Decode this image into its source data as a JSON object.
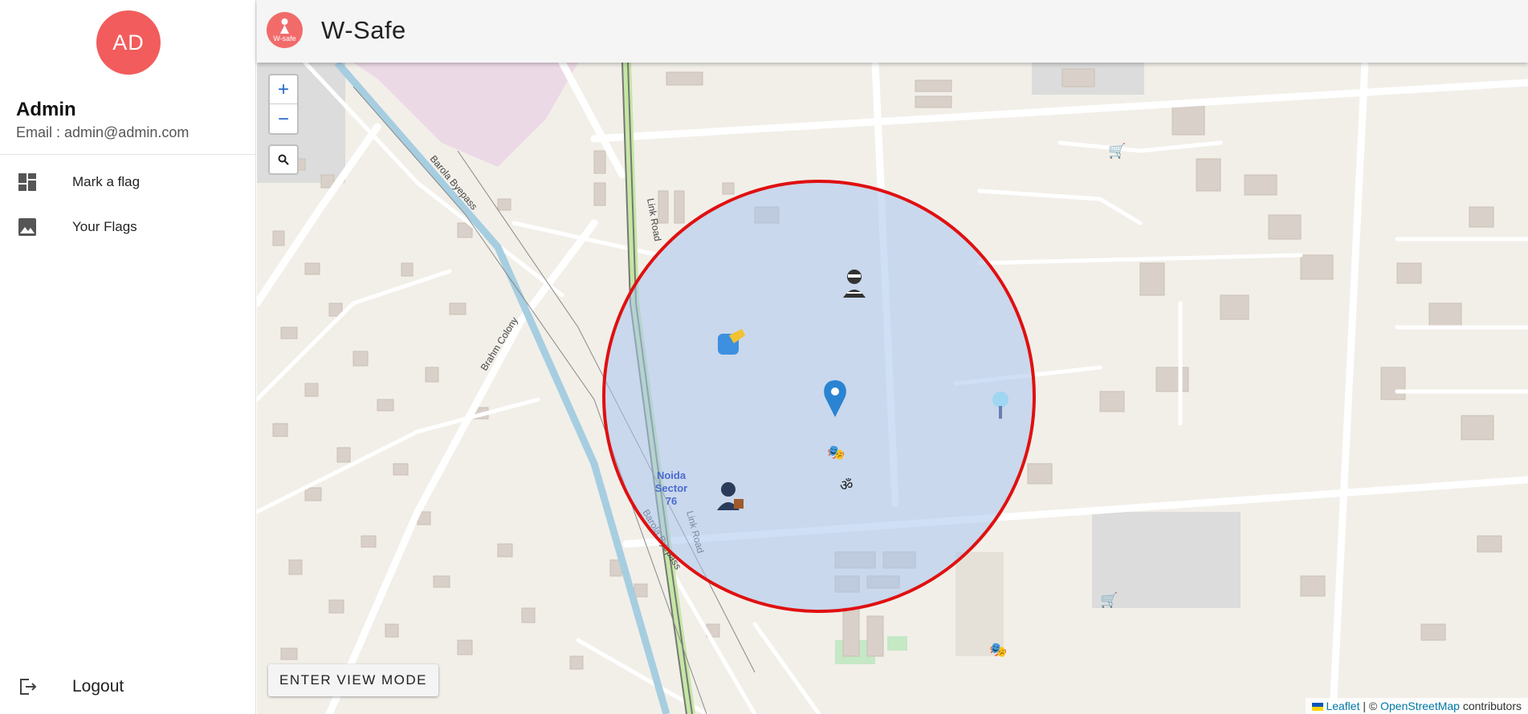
{
  "sidebar": {
    "avatar_initials": "AD",
    "user_name": "Admin",
    "user_email": "Email : admin@admin.com",
    "nav": [
      {
        "label": "Mark a flag",
        "icon": "dashboard-icon"
      },
      {
        "label": "Your Flags",
        "icon": "image-icon"
      }
    ],
    "logout_label": "Logout"
  },
  "header": {
    "logo_text": "W-safe",
    "title": "W-Safe"
  },
  "map": {
    "zoom_in": "+",
    "zoom_out": "−",
    "search_icon": "search-icon",
    "view_mode_label": "ENTER VIEW MODE",
    "labels": {
      "link_road": "Link Road",
      "barola_byepass": "Barola Byepass",
      "brahm_colony": "Brahm Colony",
      "noida_sector_1": "Noida",
      "noida_sector_2": "Sector",
      "noida_sector_3": "76"
    },
    "attribution": {
      "leaflet": "Leaflet",
      "separator": " | © ",
      "osm": "OpenStreetMap",
      "suffix": " contributors"
    },
    "colors": {
      "circle_stroke": "#e01010",
      "circle_fill": "#a8c4ee",
      "marker": "#2a84d2",
      "accent": "#f25c5c"
    }
  }
}
